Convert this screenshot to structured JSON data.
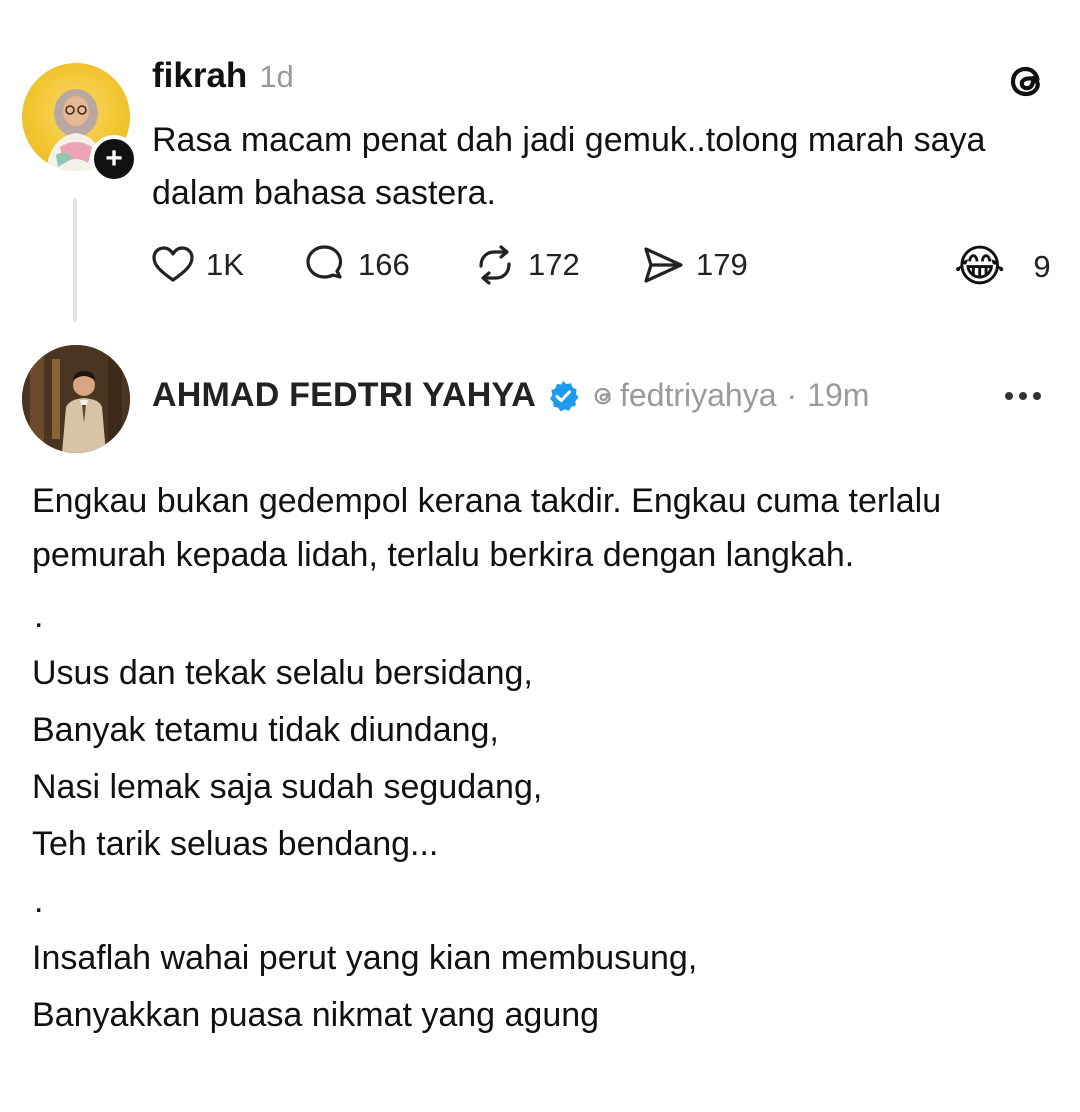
{
  "post1": {
    "username": "fikrah",
    "time": "1d",
    "text": "Rasa macam penat dah jadi gemuk..tolong marah saya dalam bahasa sastera.",
    "follow_icon": "plus-icon",
    "stats": {
      "likes": "1K",
      "replies": "166",
      "reposts": "172",
      "shares": "179",
      "reaction_emoji": "😂",
      "reaction_count": "9"
    }
  },
  "post2": {
    "display_name": "AHMAD FEDTRI YAHYA",
    "handle": "fedtriyahya",
    "separator": "·",
    "time": "19m",
    "verified_color": "#1d9bf0",
    "body": {
      "paragraph": "Engkau bukan gedempol kerana takdir. Engkau cuma terlalu pemurah kepada lidah, terlalu berkira dengan langkah.",
      "separator1": ".",
      "stanza1": [
        "Usus dan tekak selalu bersidang,",
        "Banyak tetamu tidak diundang,",
        "Nasi lemak saja sudah segudang,",
        "Teh tarik seluas bendang..."
      ],
      "separator2": ".",
      "stanza2": [
        "Insaflah wahai perut yang kian membusung,",
        "Banyakkan puasa nikmat yang agung"
      ]
    }
  },
  "icons": {
    "app_logo": "threads-logo-icon",
    "like": "heart-icon",
    "reply": "comment-icon",
    "repost": "repost-icon",
    "share": "send-icon",
    "more": "more-horizontal-icon"
  }
}
